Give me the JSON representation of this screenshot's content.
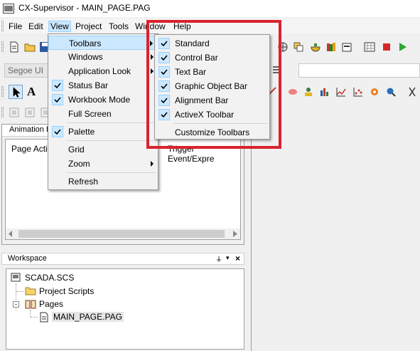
{
  "window": {
    "title": "CX-Supervisor - MAIN_PAGE.PAG"
  },
  "menubar": {
    "items": [
      "File",
      "Edit",
      "View",
      "Project",
      "Tools",
      "Window",
      "Help"
    ]
  },
  "font_toolbar": {
    "font_name": "Segoe UI"
  },
  "view_menu": {
    "toolbars": "Toolbars",
    "windows": "Windows",
    "application_look": "Application Look",
    "status_bar": "Status Bar",
    "workbook_mode": "Workbook Mode",
    "full_screen": "Full Screen",
    "palette": "Palette",
    "grid": "Grid",
    "zoom": "Zoom",
    "refresh": "Refresh"
  },
  "toolbars_menu": {
    "standard": "Standard",
    "control_bar": "Control Bar",
    "text_bar": "Text Bar",
    "graphic_object_bar": "Graphic Object Bar",
    "alignment_bar": "Alignment Bar",
    "activex_toolbar": "ActiveX Toolbar",
    "customize": "Customize Toolbars"
  },
  "animation_panel": {
    "title": "Animation E",
    "column_action": "Page Actic",
    "column_trigger": "Trigger Event/Expre"
  },
  "workspace": {
    "title": "Workspace",
    "tree": {
      "root": "SCADA.SCS",
      "project_scripts": "Project Scripts",
      "pages": "Pages",
      "main_page": "MAIN_PAGE.PAG"
    }
  },
  "colors": {
    "highlight_box": "#d9232e",
    "menu_hover": "#cce8ff",
    "menu_hover_border": "#99d1ff"
  }
}
